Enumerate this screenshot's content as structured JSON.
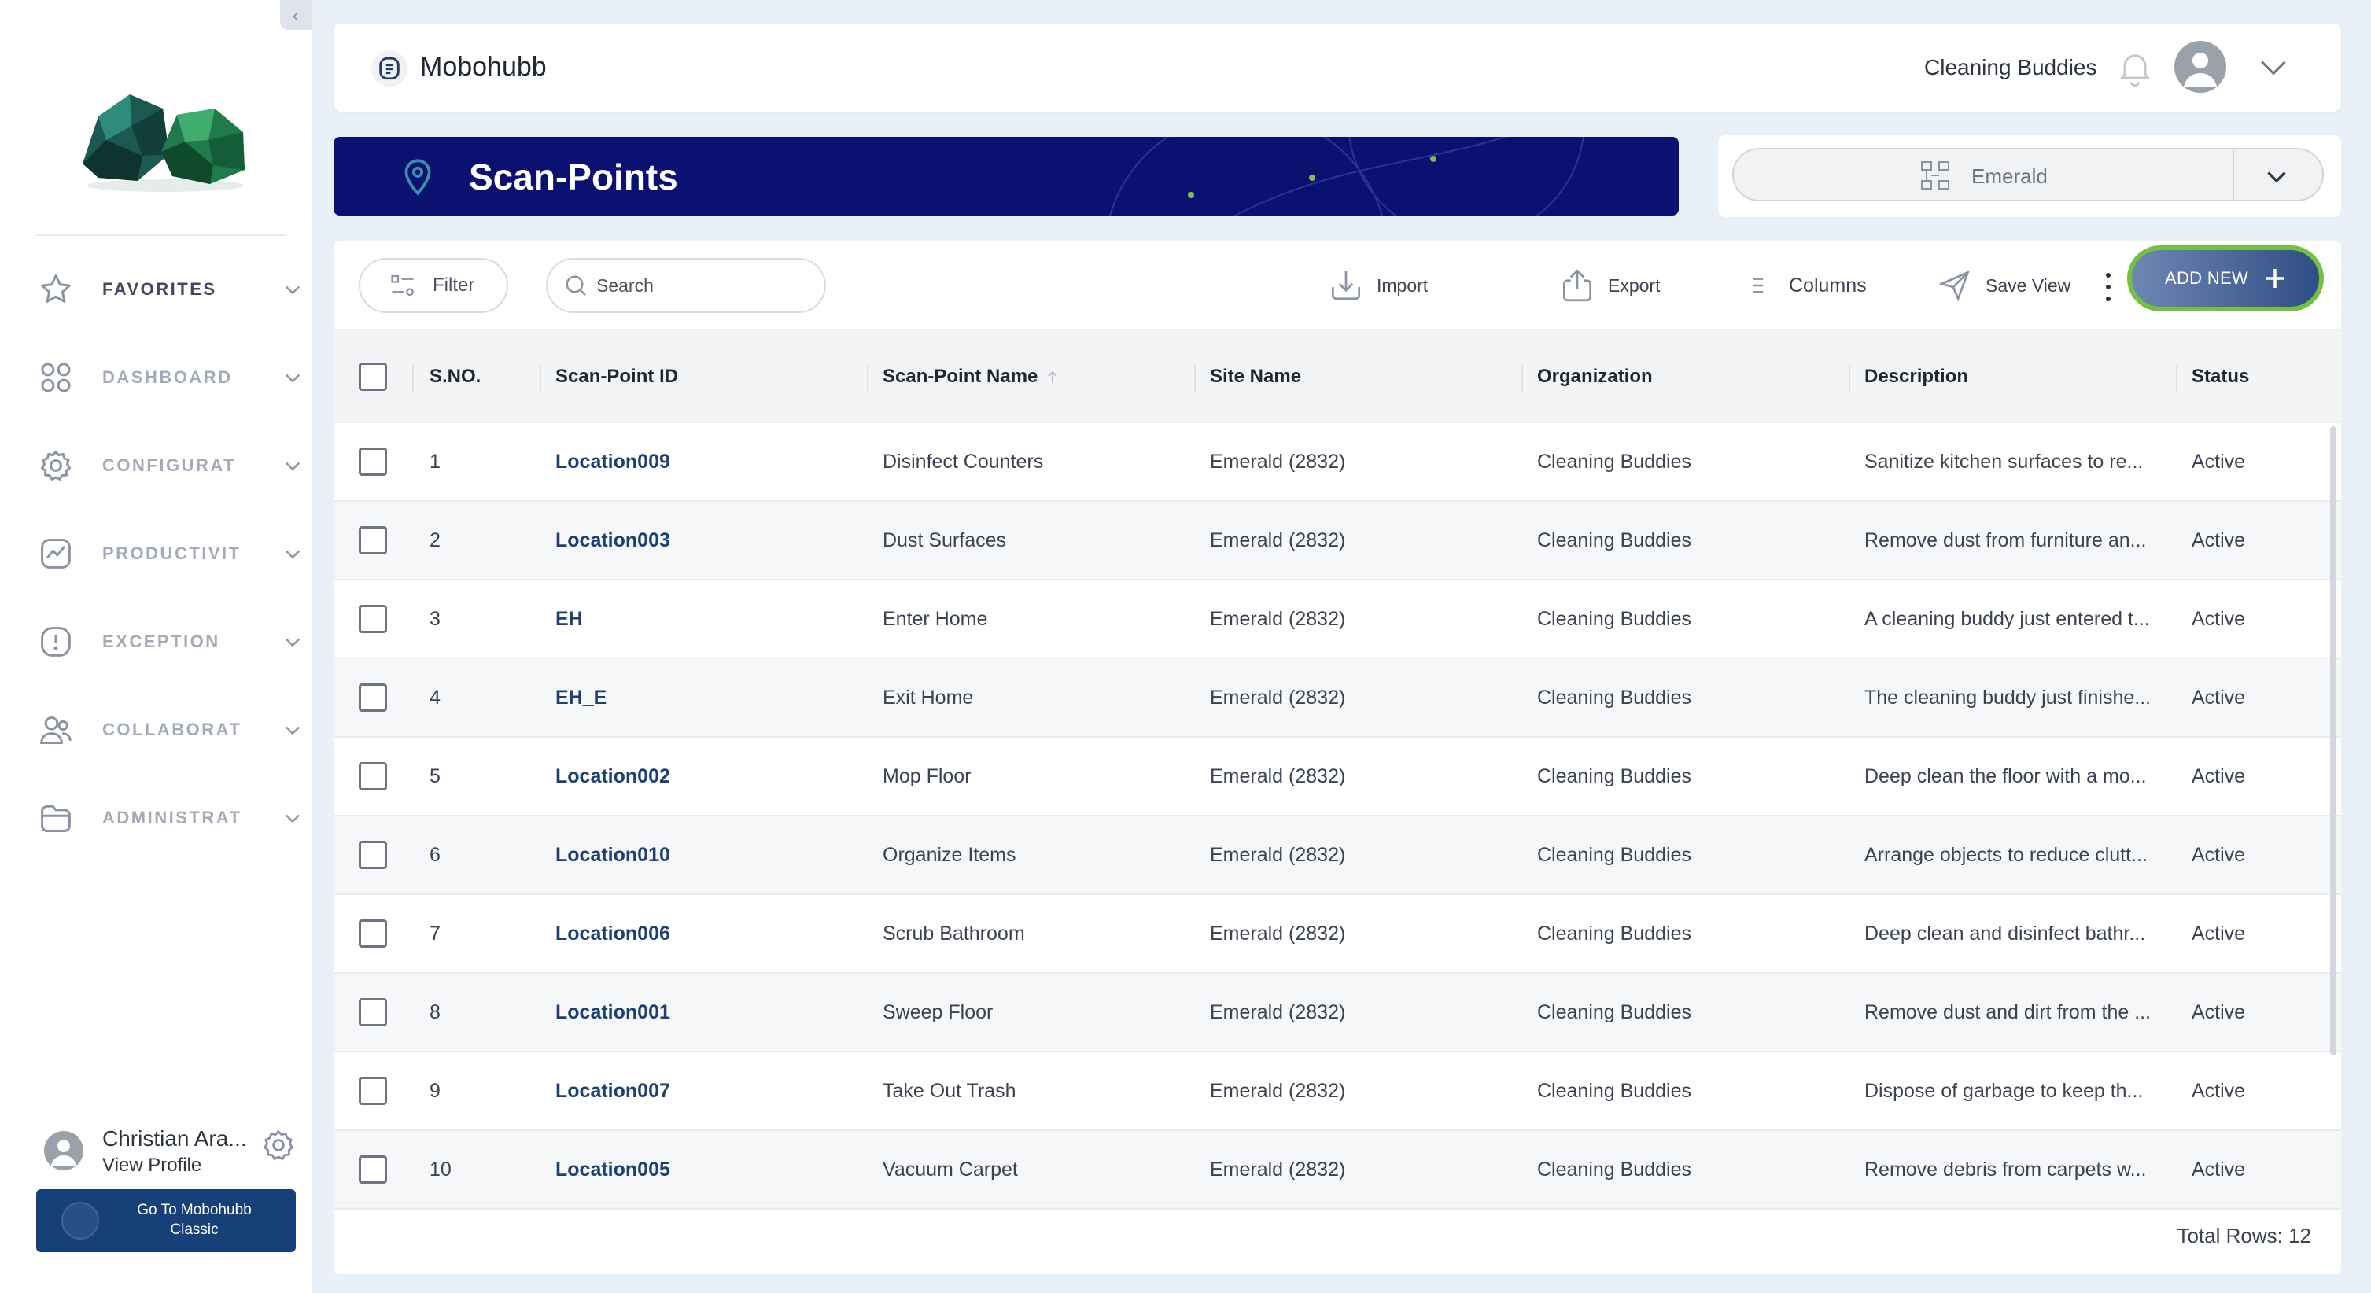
{
  "colors": {
    "navy_banner": "#0b1170",
    "link": "#1c3f74",
    "add_button_ring": "#74c043",
    "classic_button": "#173f78"
  },
  "sidebar": {
    "items": [
      {
        "label": "FAVORITES",
        "icon": "star-icon"
      },
      {
        "label": "DASHBOARD",
        "icon": "grid-icon"
      },
      {
        "label": "CONFIGURAT",
        "icon": "gear-icon"
      },
      {
        "label": "PRODUCTIVIT",
        "icon": "trend-chart-icon"
      },
      {
        "label": "EXCEPTION",
        "icon": "alert-icon"
      },
      {
        "label": "COLLABORAT",
        "icon": "users-icon"
      },
      {
        "label": "ADMINISTRAT",
        "icon": "folder-icon"
      }
    ],
    "profile": {
      "name": "Christian Ara...",
      "link": "View Profile"
    },
    "classic_button": {
      "line1": "Go To Mobohubb",
      "line2": "Classic"
    }
  },
  "header": {
    "brand": "Mobohubb",
    "organization": "Cleaning Buddies"
  },
  "banner": {
    "title": "Scan-Points"
  },
  "site_selector": {
    "value": "Emerald"
  },
  "toolbar": {
    "filter": "Filter",
    "search_placeholder": "Search",
    "import": "Import",
    "export": "Export",
    "columns": "Columns",
    "save_view": "Save View",
    "add_new": "ADD NEW"
  },
  "table": {
    "columns": [
      "S.NO.",
      "Scan-Point ID",
      "Scan-Point Name",
      "Site Name",
      "Organization",
      "Description",
      "Status"
    ],
    "rows": [
      {
        "sno": "1",
        "id": "Location009",
        "name": "Disinfect Counters",
        "site": "Emerald (2832)",
        "org": "Cleaning Buddies",
        "desc": "Sanitize kitchen surfaces to re...",
        "status": "Active"
      },
      {
        "sno": "2",
        "id": "Location003",
        "name": "Dust Surfaces",
        "site": "Emerald (2832)",
        "org": "Cleaning Buddies",
        "desc": "Remove dust from furniture an...",
        "status": "Active"
      },
      {
        "sno": "3",
        "id": "EH",
        "name": "Enter Home",
        "site": "Emerald (2832)",
        "org": "Cleaning Buddies",
        "desc": "A cleaning buddy just entered t...",
        "status": "Active"
      },
      {
        "sno": "4",
        "id": "EH_E",
        "name": "Exit Home",
        "site": "Emerald (2832)",
        "org": "Cleaning Buddies",
        "desc": "The cleaning buddy just finishe...",
        "status": "Active"
      },
      {
        "sno": "5",
        "id": "Location002",
        "name": "Mop Floor",
        "site": "Emerald (2832)",
        "org": "Cleaning Buddies",
        "desc": "Deep clean the floor with a mo...",
        "status": "Active"
      },
      {
        "sno": "6",
        "id": "Location010",
        "name": "Organize Items",
        "site": "Emerald (2832)",
        "org": "Cleaning Buddies",
        "desc": "Arrange objects to reduce clutt...",
        "status": "Active"
      },
      {
        "sno": "7",
        "id": "Location006",
        "name": "Scrub Bathroom",
        "site": "Emerald (2832)",
        "org": "Cleaning Buddies",
        "desc": "Deep clean and disinfect bathr...",
        "status": "Active"
      },
      {
        "sno": "8",
        "id": "Location001",
        "name": "Sweep Floor",
        "site": "Emerald (2832)",
        "org": "Cleaning Buddies",
        "desc": "Remove dust and dirt from the ...",
        "status": "Active"
      },
      {
        "sno": "9",
        "id": "Location007",
        "name": "Take Out Trash",
        "site": "Emerald (2832)",
        "org": "Cleaning Buddies",
        "desc": "Dispose of garbage to keep th...",
        "status": "Active"
      },
      {
        "sno": "10",
        "id": "Location005",
        "name": "Vacuum Carpet",
        "site": "Emerald (2832)",
        "org": "Cleaning Buddies",
        "desc": "Remove debris from carpets w...",
        "status": "Active"
      }
    ],
    "total_rows": "Total Rows: 12"
  }
}
